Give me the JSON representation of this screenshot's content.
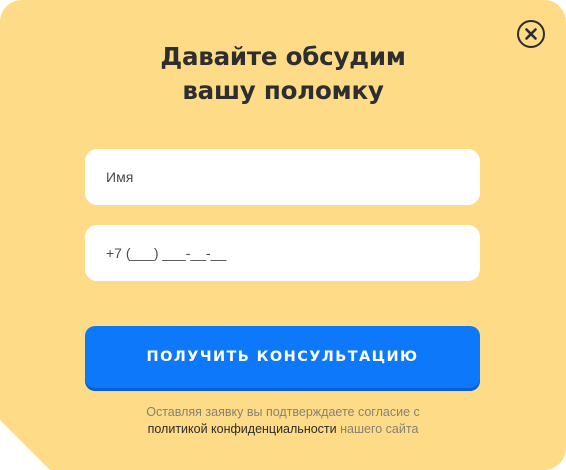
{
  "modal": {
    "title_line1": "Давайте обсудим",
    "title_line2": "вашу поломку",
    "close_icon": "close-icon",
    "background_color": "#fedb86"
  },
  "form": {
    "name_placeholder": "Имя",
    "phone_placeholder": "+7 (___) ___-__-__",
    "submit_label": "ПОЛУЧИТЬ КОНСУЛЬТАЦИЮ",
    "submit_color": "#0d78fa"
  },
  "consent": {
    "text_line1": "Оставляя заявку вы подтверждаете согласие с",
    "policy_link": "политикой конфиденциальности",
    "text_tail": "нашего сайта"
  }
}
